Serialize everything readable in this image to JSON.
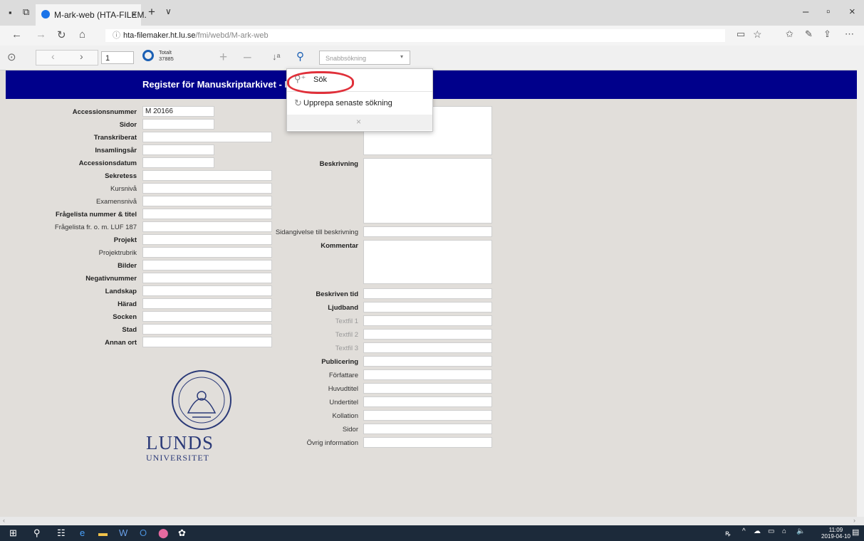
{
  "browser": {
    "tab_title": "M-ark-web (HTA-FILEM.",
    "url_host": "hta-filemaker.ht.lu.se",
    "url_path": "/fmi/webd/M-ark-web"
  },
  "toolbar": {
    "record_number": "1",
    "total_label": "Totalt",
    "total_count": "37885",
    "quick_search_placeholder": "Snabbsökning"
  },
  "header": {
    "title": "Register för Manuskriptarkivet - M"
  },
  "search_menu": {
    "items": [
      {
        "label": "Sök"
      },
      {
        "label": "Upprepa senaste sökning"
      }
    ]
  },
  "form_left": {
    "fields": [
      {
        "label": "Accessionsnummer",
        "value": "M 20166"
      },
      {
        "label": "Sidor",
        "value": ""
      },
      {
        "label": "Transkriberat",
        "value": ""
      },
      {
        "label": "Insamlingsår",
        "value": ""
      },
      {
        "label": "Accessionsdatum",
        "value": ""
      },
      {
        "label": "Sekretess",
        "value": ""
      },
      {
        "label": "Kursnivå",
        "value": ""
      },
      {
        "label": "Examensnivå",
        "value": ""
      },
      {
        "label": "Frågelista nummer & titel",
        "value": ""
      },
      {
        "label": "Frågelista fr. o. m. LUF 187",
        "value": ""
      },
      {
        "label": "Projekt",
        "value": ""
      },
      {
        "label": "Projektrubrik",
        "value": ""
      },
      {
        "label": "Bilder",
        "value": ""
      },
      {
        "label": "Negativnummer",
        "value": ""
      },
      {
        "label": "Landskap",
        "value": ""
      },
      {
        "label": "Härad",
        "value": ""
      },
      {
        "label": "Socken",
        "value": ""
      },
      {
        "label": "Stad",
        "value": ""
      },
      {
        "label": "Annan ort",
        "value": ""
      }
    ]
  },
  "form_right": {
    "fields": [
      {
        "label": "Beskrivning",
        "value": ""
      },
      {
        "label": "Sidangivelse till beskrivning",
        "value": ""
      },
      {
        "label": "Kommentar",
        "value": ""
      },
      {
        "label": "Beskriven tid",
        "value": ""
      },
      {
        "label": "Ljudband",
        "value": ""
      },
      {
        "label": "Textfil 1",
        "value": ""
      },
      {
        "label": "Textfil 2",
        "value": ""
      },
      {
        "label": "Textfil 3",
        "value": ""
      },
      {
        "label": "Publicering",
        "value": ""
      },
      {
        "label": "Författare",
        "value": ""
      },
      {
        "label": "Huvudtitel",
        "value": ""
      },
      {
        "label": "Undertitel",
        "value": ""
      },
      {
        "label": "Kollation",
        "value": ""
      },
      {
        "label": "Sidor",
        "value": ""
      },
      {
        "label": "Övrig information",
        "value": ""
      }
    ]
  },
  "logo": {
    "line1": "LUNDS",
    "line2": "UNIVERSITET"
  },
  "taskbar": {
    "time": "11:09",
    "date": "2019-04-10"
  },
  "colors": {
    "header_band": "#00008b",
    "highlight_ring": "#e0303a",
    "logo": "#2b3a78"
  }
}
